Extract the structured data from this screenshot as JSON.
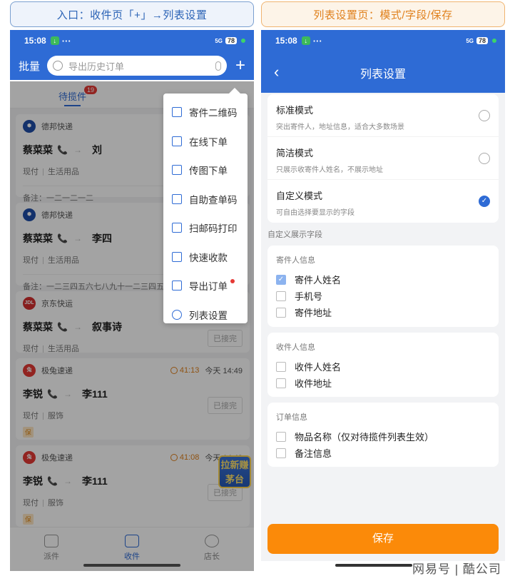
{
  "banners": {
    "left": "入口：收件页「+」→列表设置",
    "right": "列表设置页：模式/字段/保存"
  },
  "status": {
    "time": "15:08",
    "dots": "···",
    "network": "5G",
    "battery": "78"
  },
  "left": {
    "batch": "批量",
    "search_placeholder": "导出历史订单",
    "plus": "+",
    "tab": "待揽件",
    "tab_badge": "19",
    "cards": [
      {
        "company": "德邦快递",
        "sender": "蔡菜菜",
        "receiver": "刘",
        "pay": "现付",
        "goods": "生活用品",
        "note": "备注：一二一二一二"
      },
      {
        "company": "德邦快递",
        "sender": "蔡菜菜",
        "receiver": "李四",
        "pay": "现付",
        "goods": "生活用品",
        "note": "备注：一二三四五六七八九十一二三四五六七"
      },
      {
        "company": "京东快运",
        "logo": "JDL",
        "sender": "蔡菜菜",
        "receiver": "叙事诗",
        "pay": "现付",
        "goods": "生活用品",
        "status": "已接完"
      },
      {
        "company": "极兔速递",
        "timer": "41:13",
        "time": "今天 14:49",
        "sender": "李锐",
        "receiver": "李111",
        "pay": "现付",
        "goods": "服饰",
        "status": "已接完",
        "tag": "保"
      },
      {
        "company": "极兔速递",
        "timer": "41:08",
        "time": "今天 14:49",
        "sender": "李锐",
        "receiver": "李111",
        "pay": "现付",
        "goods": "服饰",
        "status": "已接完",
        "tag": "保"
      }
    ],
    "menu": [
      "寄件二维码",
      "在线下单",
      "传图下单",
      "自助查单码",
      "扫邮码打印",
      "快速收款",
      "导出订单",
      "列表设置"
    ],
    "float_badge": [
      "拉新赚",
      "茅台"
    ],
    "nav": [
      "派件",
      "收件",
      "店长"
    ]
  },
  "right": {
    "title": "列表设置",
    "modes": [
      {
        "title": "标准模式",
        "desc": "突出寄件人，地址信息，适合大多数场景",
        "selected": false
      },
      {
        "title": "简洁模式",
        "desc": "只展示收寄件人姓名，不展示地址",
        "selected": false
      },
      {
        "title": "自定义模式",
        "desc": "可自由选择要显示的字段",
        "selected": true
      }
    ],
    "custom_label": "自定义展示字段",
    "groups": [
      {
        "title": "寄件人信息",
        "items": [
          {
            "label": "寄件人姓名",
            "checked": true
          },
          {
            "label": "手机号",
            "checked": false
          },
          {
            "label": "寄件地址",
            "checked": false
          }
        ]
      },
      {
        "title": "收件人信息",
        "items": [
          {
            "label": "收件人姓名",
            "checked": false
          },
          {
            "label": "收件地址",
            "checked": false
          }
        ]
      },
      {
        "title": "订单信息",
        "items": [
          {
            "label": "物品名称（仅对待揽件列表生效）",
            "checked": false
          },
          {
            "label": "备注信息",
            "checked": false
          }
        ]
      }
    ],
    "save": "保存"
  },
  "watermark": "网易号 | 酷公司",
  "colors": {
    "brand_blue": "#2e6bd5",
    "orange": "#fb8a09",
    "red": "#e53935"
  }
}
